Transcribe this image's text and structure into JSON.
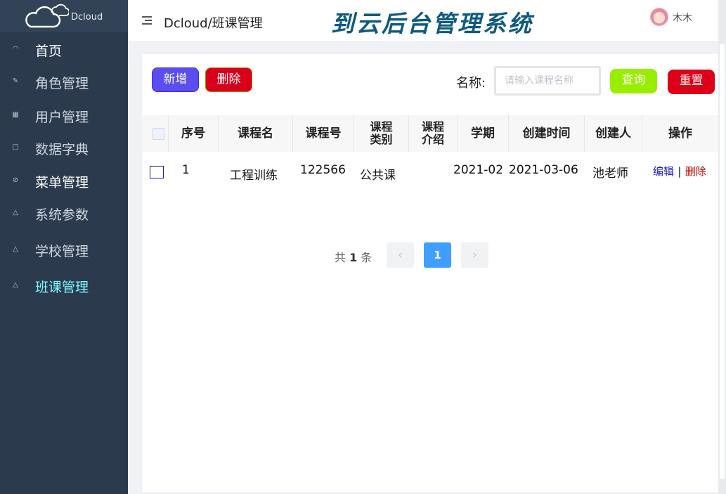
{
  "sidebar": {
    "logo_text": "Dcloud",
    "items": [
      {
        "label": "首页",
        "icon": "home-icon"
      },
      {
        "label": "角色管理",
        "icon": "edit-icon"
      },
      {
        "label": "用户管理",
        "icon": "grid-icon"
      },
      {
        "label": "数据字典",
        "icon": "square-icon"
      },
      {
        "label": "菜单管理",
        "icon": "circle-check-icon"
      },
      {
        "label": "系统参数",
        "icon": "warning-icon"
      },
      {
        "label": "学校管理",
        "icon": "warning-icon"
      },
      {
        "label": "班课管理",
        "icon": "warning-icon"
      }
    ],
    "active_item": "班课管理"
  },
  "header": {
    "breadcrumb": "Dcloud/班课管理",
    "system_title": "到云后台管理系统",
    "username": "木木"
  },
  "toolbar": {
    "add_label": "新增",
    "delete_label": "删除",
    "search_label": "名称:",
    "search_placeholder": "请输入课程名称",
    "search_value": "",
    "query_label": "查询",
    "reset_label": "重置"
  },
  "table": {
    "columns": [
      "序号",
      "课程名",
      "课程号",
      "课程\n类别",
      "课程\n介绍",
      "学期",
      "创建时间",
      "创建人",
      "操作"
    ],
    "rows": [
      {
        "index": "1",
        "course_name": "工程训练",
        "course_no": "122566",
        "course_type": "公共课",
        "course_intro": "",
        "semester": "2021-02",
        "created_at": "2021-03-06",
        "creator": "池老师",
        "edit_label": "编辑",
        "separator": "|",
        "delete_label": "删除"
      }
    ]
  },
  "pagination": {
    "total_prefix": "共",
    "total": "1",
    "total_suffix": "条",
    "prev": "‹",
    "current_page": "1",
    "next": "›"
  },
  "colors": {
    "sidebar_bg": "#2b3a4d",
    "active_menu": "#7ff7ff",
    "add_button": "#5a4ef0",
    "delete_button": "#d8001b",
    "query_button": "#99ee00",
    "reset_button": "#dd0016",
    "title_color": "#0f5a80",
    "page_active": "#409eff"
  }
}
